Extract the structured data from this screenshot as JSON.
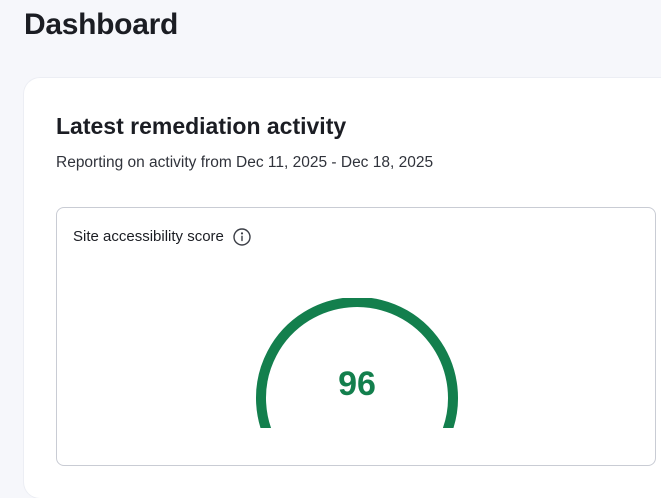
{
  "header": {
    "title": "Dashboard"
  },
  "activity": {
    "title": "Latest remediation activity",
    "subtitle": "Reporting on activity from Dec 11, 2025 - Dec 18, 2025"
  },
  "score_card": {
    "title": "Site accessibility score",
    "info_icon": "info-circle-icon",
    "score": "96",
    "score_fraction": 0.96,
    "colors": {
      "fill": "#137f4d",
      "track": "#e4e9f8",
      "text": "#137f4d"
    }
  }
}
